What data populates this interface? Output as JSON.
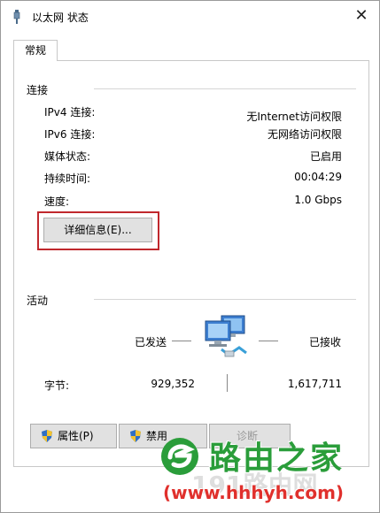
{
  "window": {
    "title": "以太网 状态",
    "close_glyph": "✕"
  },
  "tabs": [
    {
      "label": "常规",
      "selected": true
    }
  ],
  "connection": {
    "title": "连接",
    "rows": [
      {
        "label": "IPv4 连接:",
        "value": "无Internet访问权限"
      },
      {
        "label": "IPv6 连接:",
        "value": "无网络访问权限"
      },
      {
        "label": "媒体状态:",
        "value": "已启用"
      },
      {
        "label": "持续时间:",
        "value": "00:04:29"
      },
      {
        "label": "速度:",
        "value": "1.0 Gbps"
      }
    ],
    "details_button": "详细信息(E)..."
  },
  "activity": {
    "title": "活动",
    "sent_label": "已发送",
    "received_label": "已接收",
    "bytes_label": "字节:",
    "bytes_sent": "929,352",
    "bytes_received": "1,617,711"
  },
  "buttons": {
    "properties": "属性(P)",
    "disable": "禁用",
    "diagnose": "诊断"
  },
  "watermark": {
    "brand": "路由之家",
    "url": "(www.hhhyh.com)",
    "ghost": "191路由网"
  },
  "colors": {
    "highlight_border": "#c0282d",
    "watermark_green": "#2a9d3a",
    "watermark_red": "#e0302c"
  },
  "icons": {
    "title": "network-cable-icon",
    "activity": "network-computers-icon",
    "button_shield": "uac-shield-icon"
  }
}
